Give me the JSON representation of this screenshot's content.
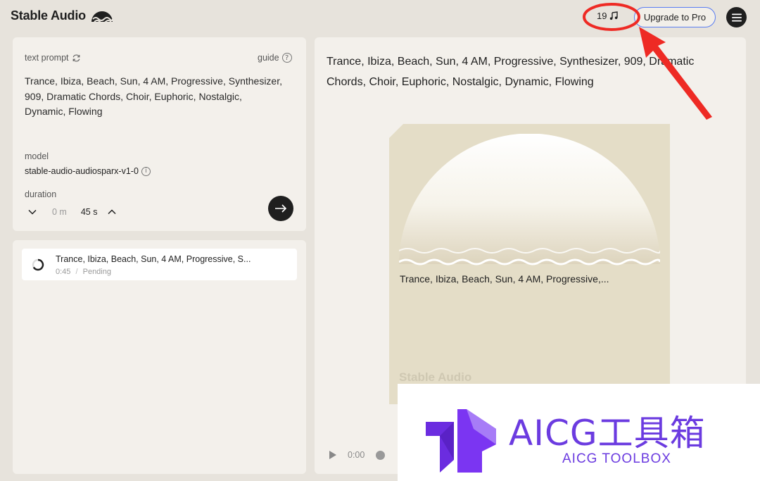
{
  "header": {
    "app_name": "Stable Audio",
    "logo_icon": "half-sun-wave-icon",
    "credits": "19",
    "credits_icon": "music-note-icon",
    "upgrade_label": "Upgrade to Pro",
    "menu_icon": "hamburger-icon"
  },
  "prompt_panel": {
    "prompt_label": "text prompt",
    "refresh_icon": "refresh-icon",
    "guide_label": "guide",
    "guide_icon": "help-circle-icon",
    "prompt_text": "Trance, Ibiza, Beach, Sun, 4 AM, Progressive, Synthesizer, 909, Dramatic Chords, Choir, Euphoric, Nostalgic, Dynamic, Flowing",
    "model_label": "model",
    "model_value": "stable-audio-audiosparx-v1-0",
    "info_glyph": "i",
    "duration_label": "duration",
    "duration_minutes": "0 m",
    "duration_seconds": "45 s",
    "submit_icon": "arrow-right-icon"
  },
  "queue": {
    "items": [
      {
        "title": "Trance, Ibiza, Beach, Sun, 4 AM, Progressive, S...",
        "duration": "0:45",
        "separator": "/",
        "status": "Pending"
      }
    ]
  },
  "main": {
    "title": "Trance, Ibiza, Beach, Sun, 4 AM, Progressive, Synthesizer, 909, Dramatic Chords, Choir, Euphoric, Nostalgic, Dynamic, Flowing",
    "cover_caption": "Trance, Ibiza, Beach, Sun, 4 AM, Progressive,...",
    "cover_brand": "Stable Audio",
    "player_time": "0:00"
  },
  "watermark": {
    "title": "AICG工具箱",
    "subtitle": "AICG TOOLBOX"
  },
  "colors": {
    "accent_border": "#5a7df2",
    "annotation_red": "#ee2a24",
    "watermark_purple": "#6b3be0",
    "background": "#e7e3dc",
    "panel": "#f3f0eb"
  }
}
